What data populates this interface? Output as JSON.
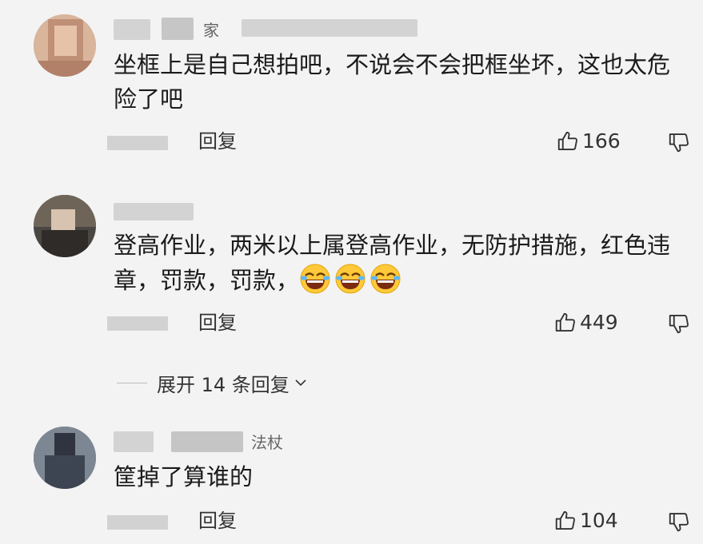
{
  "comments": [
    {
      "name_suffix": "家",
      "text": "坐框上是自己想拍吧，不说会不会把框坐坏，这也太危险了吧",
      "reply_label": "回复",
      "likes": "166"
    },
    {
      "name_suffix": "",
      "text": "登高作业，两米以上属登高作业，无防护措施，红色违章，罚款，罚款，",
      "reply_label": "回复",
      "likes": "449",
      "emoji_icons": [
        "rofl-emoji",
        "rofl-emoji",
        "rofl-emoji"
      ]
    },
    {
      "name_suffix": "法杖",
      "text": "筐掉了算谁的",
      "reply_label": "回复",
      "likes": "104"
    }
  ],
  "expand_replies": {
    "label": "展开 14 条回复"
  },
  "icons": {
    "like": "thumbs-up-icon",
    "dislike": "thumbs-down-icon",
    "expand": "chevron-down-icon"
  },
  "colors": {
    "background": "#f3f3f3",
    "text": "#1b1b1b",
    "meta": "#333333",
    "emoji_face": "#ffc93a"
  }
}
